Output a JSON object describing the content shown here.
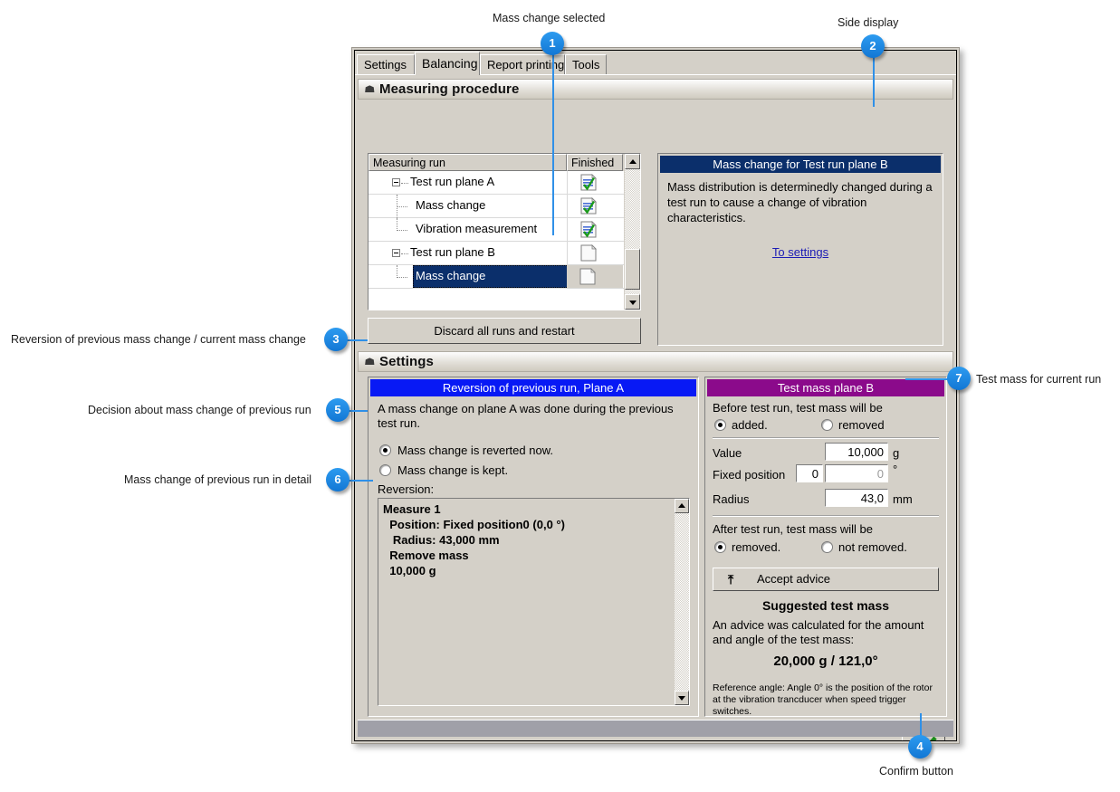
{
  "annotations": [
    {
      "n": "1",
      "label": "Mass change selected"
    },
    {
      "n": "2",
      "label": "Side display"
    },
    {
      "n": "3",
      "label": "Reversion of previous mass change / current mass change"
    },
    {
      "n": "4",
      "label": "Confirm button"
    },
    {
      "n": "5",
      "label": "Decision about mass change of previous run"
    },
    {
      "n": "6",
      "label": "Mass change of previous run in detail"
    },
    {
      "n": "7",
      "label": "Test mass for current run"
    }
  ],
  "tabs": [
    {
      "label": "Settings",
      "active": false
    },
    {
      "label": "Balancing",
      "active": true
    },
    {
      "label": "Report printing",
      "active": false
    },
    {
      "label": "Tools",
      "active": false
    }
  ],
  "sections": {
    "measuring_procedure": "Measuring procedure",
    "settings": "Settings"
  },
  "tree": {
    "columns": [
      "Measuring run",
      "Finished"
    ],
    "rows": [
      {
        "label": "Test run plane A",
        "level": 0,
        "icon": "doc-check-icon",
        "selected": false
      },
      {
        "label": "Mass change",
        "level": 1,
        "icon": "doc-check-icon",
        "selected": false
      },
      {
        "label": "Vibration measurement",
        "level": 1,
        "icon": "doc-check-icon",
        "selected": false
      },
      {
        "label": "Test run plane B",
        "level": 0,
        "icon": "doc-blank-icon",
        "selected": false
      },
      {
        "label": "Mass change",
        "level": 1,
        "icon": "doc-blank-icon",
        "selected": true
      }
    ]
  },
  "discard_button": "Discard all runs and restart",
  "side_display": {
    "title": "Mass change for Test run plane B",
    "body": "Mass distribution is determinedly changed during a test run to cause a change of vibration characteristics.",
    "link": "To settings"
  },
  "reversion_panel": {
    "title": "Reversion of previous run, Plane A",
    "intro": "A mass change on plane A was done during the previous test run.",
    "options": [
      {
        "label": "Mass change is reverted now.",
        "selected": true
      },
      {
        "label": "Mass change is kept.",
        "selected": false
      }
    ],
    "list_label": "Reversion:",
    "detail": "Measure 1\n  Position: Fixed position0 (0,0 °)\n   Radius: 43,000 mm\n  Remove mass\n  10,000 g"
  },
  "test_mass_panel": {
    "title": "Test mass plane B",
    "before_label": "Before test run, test mass will be",
    "before_options": [
      {
        "label": "added.",
        "selected": true
      },
      {
        "label": "removed",
        "selected": false
      }
    ],
    "fields": [
      {
        "label": "Value",
        "value": "10,000",
        "unit": "g",
        "secondary": null,
        "disabled": false
      },
      {
        "label": "Fixed position",
        "value": "0",
        "unit": "°",
        "secondary": "0",
        "disabled": true
      },
      {
        "label": "Radius",
        "value": "43,0",
        "unit": "mm",
        "secondary": null,
        "disabled": false
      }
    ],
    "after_label": "After test run, test mass will be",
    "after_options": [
      {
        "label": "removed.",
        "selected": true
      },
      {
        "label": "not removed.",
        "selected": false
      }
    ],
    "accept_button": "Accept advice",
    "suggested_title": "Suggested test mass",
    "suggested_text": "An advice was calculated for the amount and angle of the test mass:",
    "suggested_value": "20,000 g / 121,0°",
    "reference_note": "Reference angle: Angle 0° is the position of the rotor at the vibration trancducer when speed trigger switches."
  },
  "colors": {
    "accent_badge": "#1e88e5",
    "navy_caption": "#0b2f6b",
    "blue_caption": "#0819f5",
    "purple_caption": "#8b0a8b",
    "window_face": "#d4d0c8",
    "confirm_check": "#1a8a1a"
  }
}
